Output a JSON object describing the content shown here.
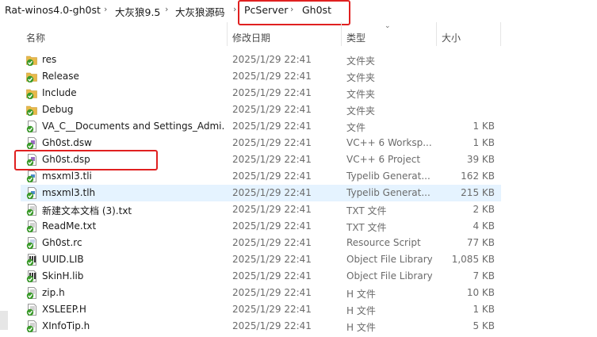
{
  "breadcrumb": [
    "Rat-winos4.0-gh0st",
    "大灰狼9.5",
    "大灰狼源码",
    "PcServer",
    "Gh0st"
  ],
  "columns": {
    "name": "名称",
    "date": "修改日期",
    "type": "类型",
    "size": "大小"
  },
  "rows": [
    {
      "name": "res",
      "date": "2025/1/29 22:41",
      "type": "文件夹",
      "size": "",
      "icon": "folder-icon"
    },
    {
      "name": "Release",
      "date": "2025/1/29 22:41",
      "type": "文件夹",
      "size": "",
      "icon": "folder-icon"
    },
    {
      "name": "Include",
      "date": "2025/1/29 22:41",
      "type": "文件夹",
      "size": "",
      "icon": "folder-icon"
    },
    {
      "name": "Debug",
      "date": "2025/1/29 22:41",
      "type": "文件夹",
      "size": "",
      "icon": "folder-icon"
    },
    {
      "name": "VA_C__Documents and Settings_Admi...",
      "date": "2025/1/29 22:41",
      "type": "文件",
      "size": "1 KB",
      "icon": "file-icon"
    },
    {
      "name": "Gh0st.dsw",
      "date": "2025/1/29 22:41",
      "type": "VC++ 6 Worksp...",
      "size": "1 KB",
      "icon": "vc-workspace-icon"
    },
    {
      "name": "Gh0st.dsp",
      "date": "2025/1/29 22:41",
      "type": "VC++ 6 Project",
      "size": "39 KB",
      "icon": "vc-project-icon"
    },
    {
      "name": "msxml3.tli",
      "date": "2025/1/29 22:41",
      "type": "Typelib Generat...",
      "size": "162 KB",
      "icon": "typelib-icon"
    },
    {
      "name": "msxml3.tlh",
      "date": "2025/1/29 22:41",
      "type": "Typelib Generat...",
      "size": "215 KB",
      "icon": "typelib-icon"
    },
    {
      "name": "新建文本文档 (3).txt",
      "date": "2025/1/29 22:41",
      "type": "TXT 文件",
      "size": "2 KB",
      "icon": "text-file-icon"
    },
    {
      "name": "ReadMe.txt",
      "date": "2025/1/29 22:41",
      "type": "TXT 文件",
      "size": "4 KB",
      "icon": "text-file-icon"
    },
    {
      "name": "Gh0st.rc",
      "date": "2025/1/29 22:41",
      "type": "Resource Script",
      "size": "77 KB",
      "icon": "resource-script-icon"
    },
    {
      "name": "UUID.LIB",
      "date": "2025/1/29 22:41",
      "type": "Object File Library",
      "size": "1,085 KB",
      "icon": "library-icon"
    },
    {
      "name": "SkinH.lib",
      "date": "2025/1/29 22:41",
      "type": "Object File Library",
      "size": "7 KB",
      "icon": "library-icon"
    },
    {
      "name": "zip.h",
      "date": "2025/1/29 22:41",
      "type": "H 文件",
      "size": "10 KB",
      "icon": "header-file-icon"
    },
    {
      "name": "XSLEEP.H",
      "date": "2025/1/29 22:41",
      "type": "H 文件",
      "size": "1 KB",
      "icon": "header-file-icon"
    },
    {
      "name": "XInfoTip.h",
      "date": "2025/1/29 22:41",
      "type": "H 文件",
      "size": "5 KB",
      "icon": "header-file-icon"
    }
  ],
  "colors": {
    "highlight_box": "#e02020",
    "selected_row": "#e5f3ff",
    "folder": "#e8b94a",
    "checkmark_badge": "#3a9a2a"
  }
}
